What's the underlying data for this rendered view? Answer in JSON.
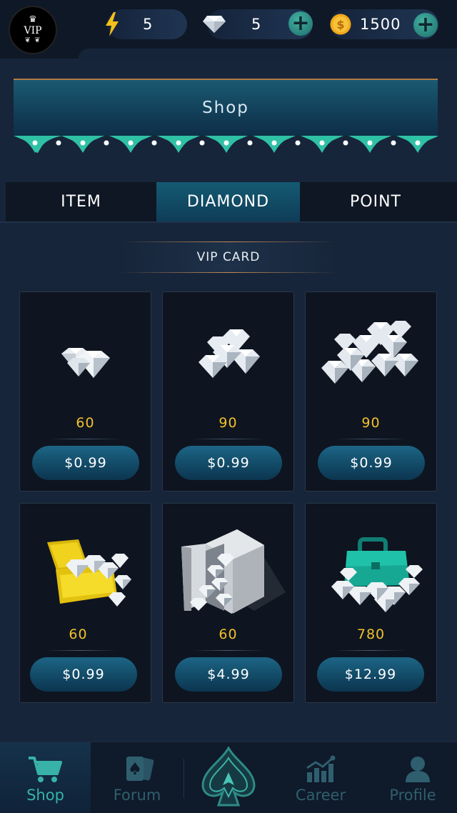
{
  "header": {
    "vip_badge": {
      "label": "VIP"
    },
    "energy": {
      "icon": "lightning-icon",
      "value": "5",
      "color": "#f4c118"
    },
    "diamonds": {
      "icon": "diamond-icon",
      "value": "5"
    },
    "coins": {
      "icon": "coin-icon",
      "value": "1500",
      "color": "#f3a91a"
    }
  },
  "banner": {
    "title": "Shop"
  },
  "tabs": [
    {
      "label": "ITEM",
      "active": false
    },
    {
      "label": "DIAMOND",
      "active": true
    },
    {
      "label": "POINT",
      "active": false
    }
  ],
  "section": {
    "title": "VIP CARD"
  },
  "products": [
    {
      "art": "small-diamonds-icon",
      "quantity": "60",
      "price": "$0.99"
    },
    {
      "art": "diamond-pile-icon",
      "quantity": "90",
      "price": "$0.99"
    },
    {
      "art": "large-diamond-pile-icon",
      "quantity": "90",
      "price": "$0.99"
    },
    {
      "art": "treasure-chest-icon",
      "quantity": "60",
      "price": "$0.99"
    },
    {
      "art": "safe-vault-icon",
      "quantity": "60",
      "price": "$4.99"
    },
    {
      "art": "briefcase-diamonds-icon",
      "quantity": "780",
      "price": "$12.99"
    }
  ],
  "nav": {
    "items": [
      {
        "label": "Shop",
        "icon": "cart-icon",
        "active": true
      },
      {
        "label": "Forum",
        "icon": "cards-icon",
        "active": false
      },
      {
        "label": "",
        "icon": "spade-logo-icon",
        "active": false
      },
      {
        "label": "Career",
        "icon": "chart-icon",
        "active": false
      },
      {
        "label": "Profile",
        "icon": "user-icon",
        "active": false
      }
    ]
  },
  "colors": {
    "accent": "#38b2a8",
    "gold": "#f3c02c",
    "background": "#17253a"
  }
}
